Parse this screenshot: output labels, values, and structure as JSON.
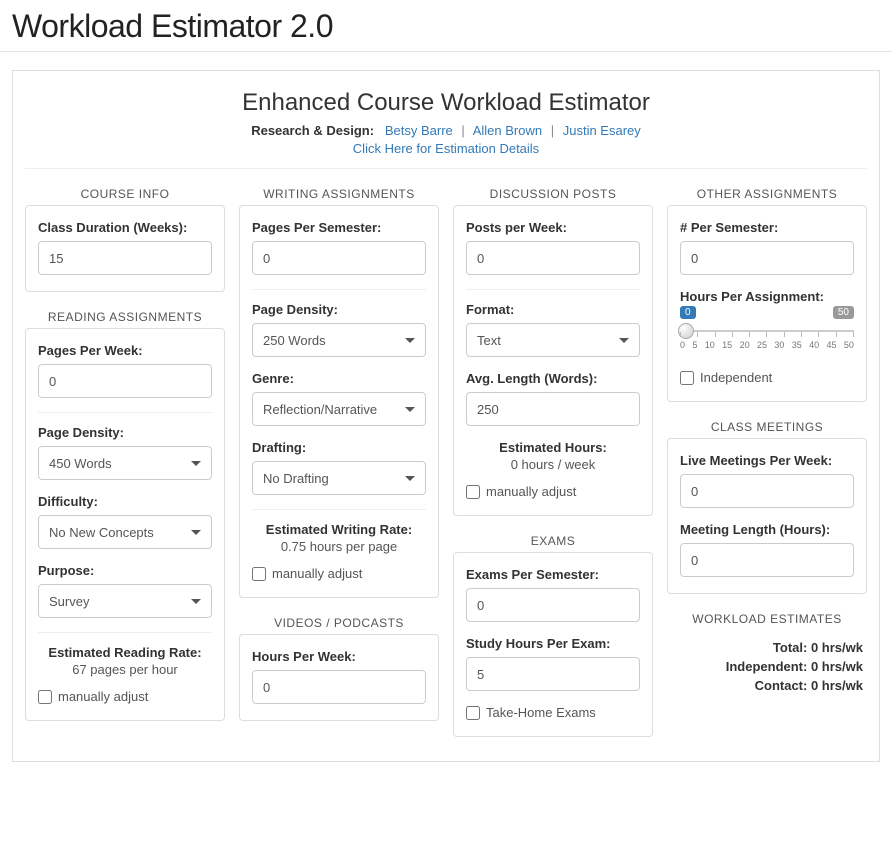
{
  "page_title": "Workload Estimator 2.0",
  "subtitle": "Enhanced Course Workload Estimator",
  "credits_label": "Research & Design:",
  "credit_links": [
    "Betsy Barre",
    "Allen Brown",
    "Justin Esarey"
  ],
  "details_link": "Click Here for Estimation Details",
  "course_info": {
    "heading": "COURSE INFO",
    "class_duration_label": "Class Duration (Weeks):",
    "class_duration_value": "15"
  },
  "reading": {
    "heading": "READING ASSIGNMENTS",
    "pages_label": "Pages Per Week:",
    "pages_value": "0",
    "density_label": "Page Density:",
    "density_selected": "450 Words",
    "difficulty_label": "Difficulty:",
    "difficulty_selected": "No New Concepts",
    "purpose_label": "Purpose:",
    "purpose_selected": "Survey",
    "rate_label": "Estimated Reading Rate:",
    "rate_value": "67 pages per hour",
    "adjust_label": "manually adjust"
  },
  "writing": {
    "heading": "WRITING ASSIGNMENTS",
    "pages_label": "Pages Per Semester:",
    "pages_value": "0",
    "density_label": "Page Density:",
    "density_selected": "250 Words",
    "genre_label": "Genre:",
    "genre_selected": "Reflection/Narrative",
    "drafting_label": "Drafting:",
    "drafting_selected": "No Drafting",
    "rate_label": "Estimated Writing Rate:",
    "rate_value": "0.75 hours per page",
    "adjust_label": "manually adjust"
  },
  "videos": {
    "heading": "VIDEOS / PODCASTS",
    "hours_label": "Hours Per Week:",
    "hours_value": "0"
  },
  "discussion": {
    "heading": "DISCUSSION POSTS",
    "posts_label": "Posts per Week:",
    "posts_value": "0",
    "format_label": "Format:",
    "format_selected": "Text",
    "length_label": "Avg. Length (Words):",
    "length_value": "250",
    "est_label": "Estimated Hours:",
    "est_value": "0 hours / week",
    "adjust_label": "manually adjust"
  },
  "exams": {
    "heading": "EXAMS",
    "exams_label": "Exams Per Semester:",
    "exams_value": "0",
    "study_label": "Study Hours Per Exam:",
    "study_value": "5",
    "takehome_label": "Take-Home Exams"
  },
  "other": {
    "heading": "OTHER ASSIGNMENTS",
    "num_label": "# Per Semester:",
    "num_value": "0",
    "hours_label": "Hours Per Assignment:",
    "slider_min": "0",
    "slider_max": "50",
    "slider_ticks": [
      "0",
      "5",
      "10",
      "15",
      "20",
      "25",
      "30",
      "35",
      "40",
      "45",
      "50"
    ],
    "independent_label": "Independent"
  },
  "meetings": {
    "heading": "CLASS MEETINGS",
    "live_label": "Live Meetings Per Week:",
    "live_value": "0",
    "length_label": "Meeting Length (Hours):",
    "length_value": "0"
  },
  "estimates": {
    "heading": "WORKLOAD ESTIMATES",
    "total_label": "Total:",
    "total_value": "0 hrs/wk",
    "independent_label": "Independent:",
    "independent_value": "0 hrs/wk",
    "contact_label": "Contact:",
    "contact_value": "0 hrs/wk"
  }
}
